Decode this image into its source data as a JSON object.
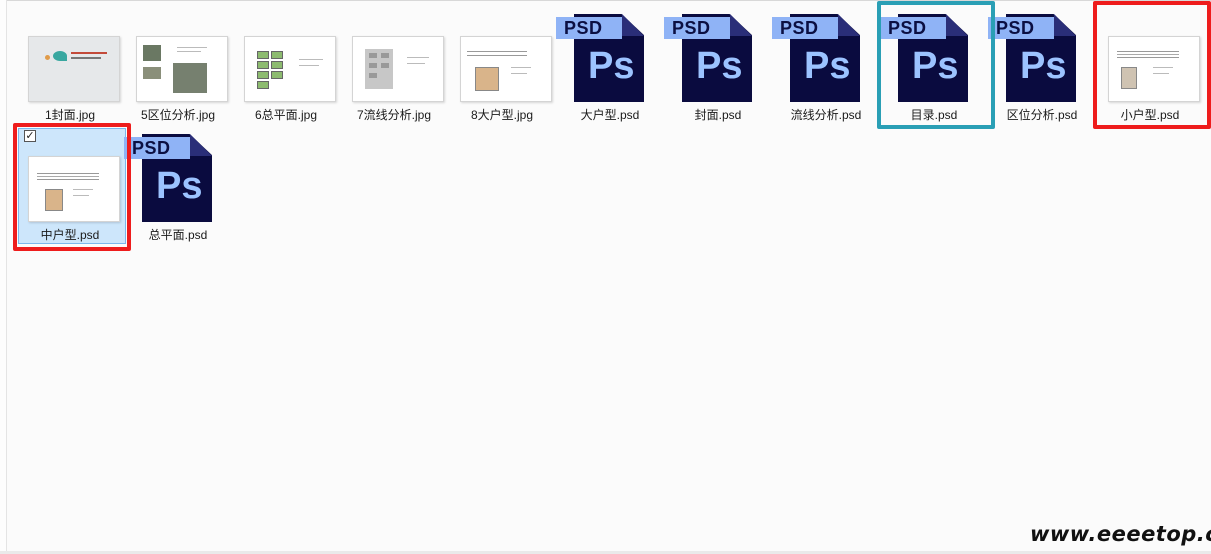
{
  "files": [
    {
      "name": "1封面.jpg",
      "type": "jpg"
    },
    {
      "name": "5区位分析.jpg",
      "type": "jpg"
    },
    {
      "name": "6总平面.jpg",
      "type": "jpg"
    },
    {
      "name": "7流线分析.jpg",
      "type": "jpg"
    },
    {
      "name": "8大户型.jpg",
      "type": "jpg"
    },
    {
      "name": "大户型.psd",
      "type": "psd"
    },
    {
      "name": "封面.psd",
      "type": "psd"
    },
    {
      "name": "流线分析.psd",
      "type": "psd"
    },
    {
      "name": "目录.psd",
      "type": "psd"
    },
    {
      "name": "区位分析.psd",
      "type": "psd"
    },
    {
      "name": "小户型.psd",
      "type": "psd"
    },
    {
      "name": "中户型.psd",
      "type": "psd",
      "selected": true
    },
    {
      "name": "总平面.psd",
      "type": "psd"
    }
  ],
  "psd_icon": {
    "tag": "PSD",
    "glyph": "Ps"
  },
  "checkbox_mark": "✓",
  "watermark": "www.eeeetop.com",
  "colors": {
    "highlight_red": "#ee1c1c",
    "highlight_teal": "#2a9fb5",
    "selection": "#cde6fb",
    "psd_dark": "#0a0b3f",
    "psd_light": "#8fb3f6"
  }
}
